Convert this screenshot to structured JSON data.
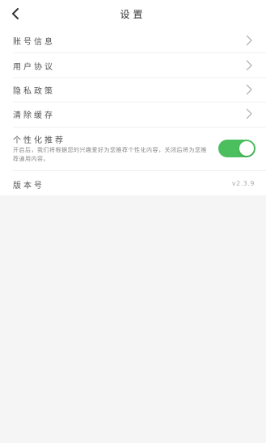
{
  "header": {
    "title": "设置",
    "back_icon": "chevron-left-icon"
  },
  "menu": [
    {
      "label": "账号信息",
      "icon": "chevron-right-icon"
    },
    {
      "label": "用户协议",
      "icon": "chevron-right-icon"
    },
    {
      "label": "隐私政策",
      "icon": "chevron-right-icon"
    },
    {
      "label": "清除缓存",
      "icon": "chevron-right-icon"
    }
  ],
  "recommend": {
    "label": "个性化推荐",
    "description": "开启后，我们将根据您的兴趣爱好为您推荐个性化内容，关闭后将为您推荐通用内容。",
    "enabled": true,
    "on_color": "#4bbf5e"
  },
  "version": {
    "label": "版本号",
    "value": "v2.3.9"
  }
}
